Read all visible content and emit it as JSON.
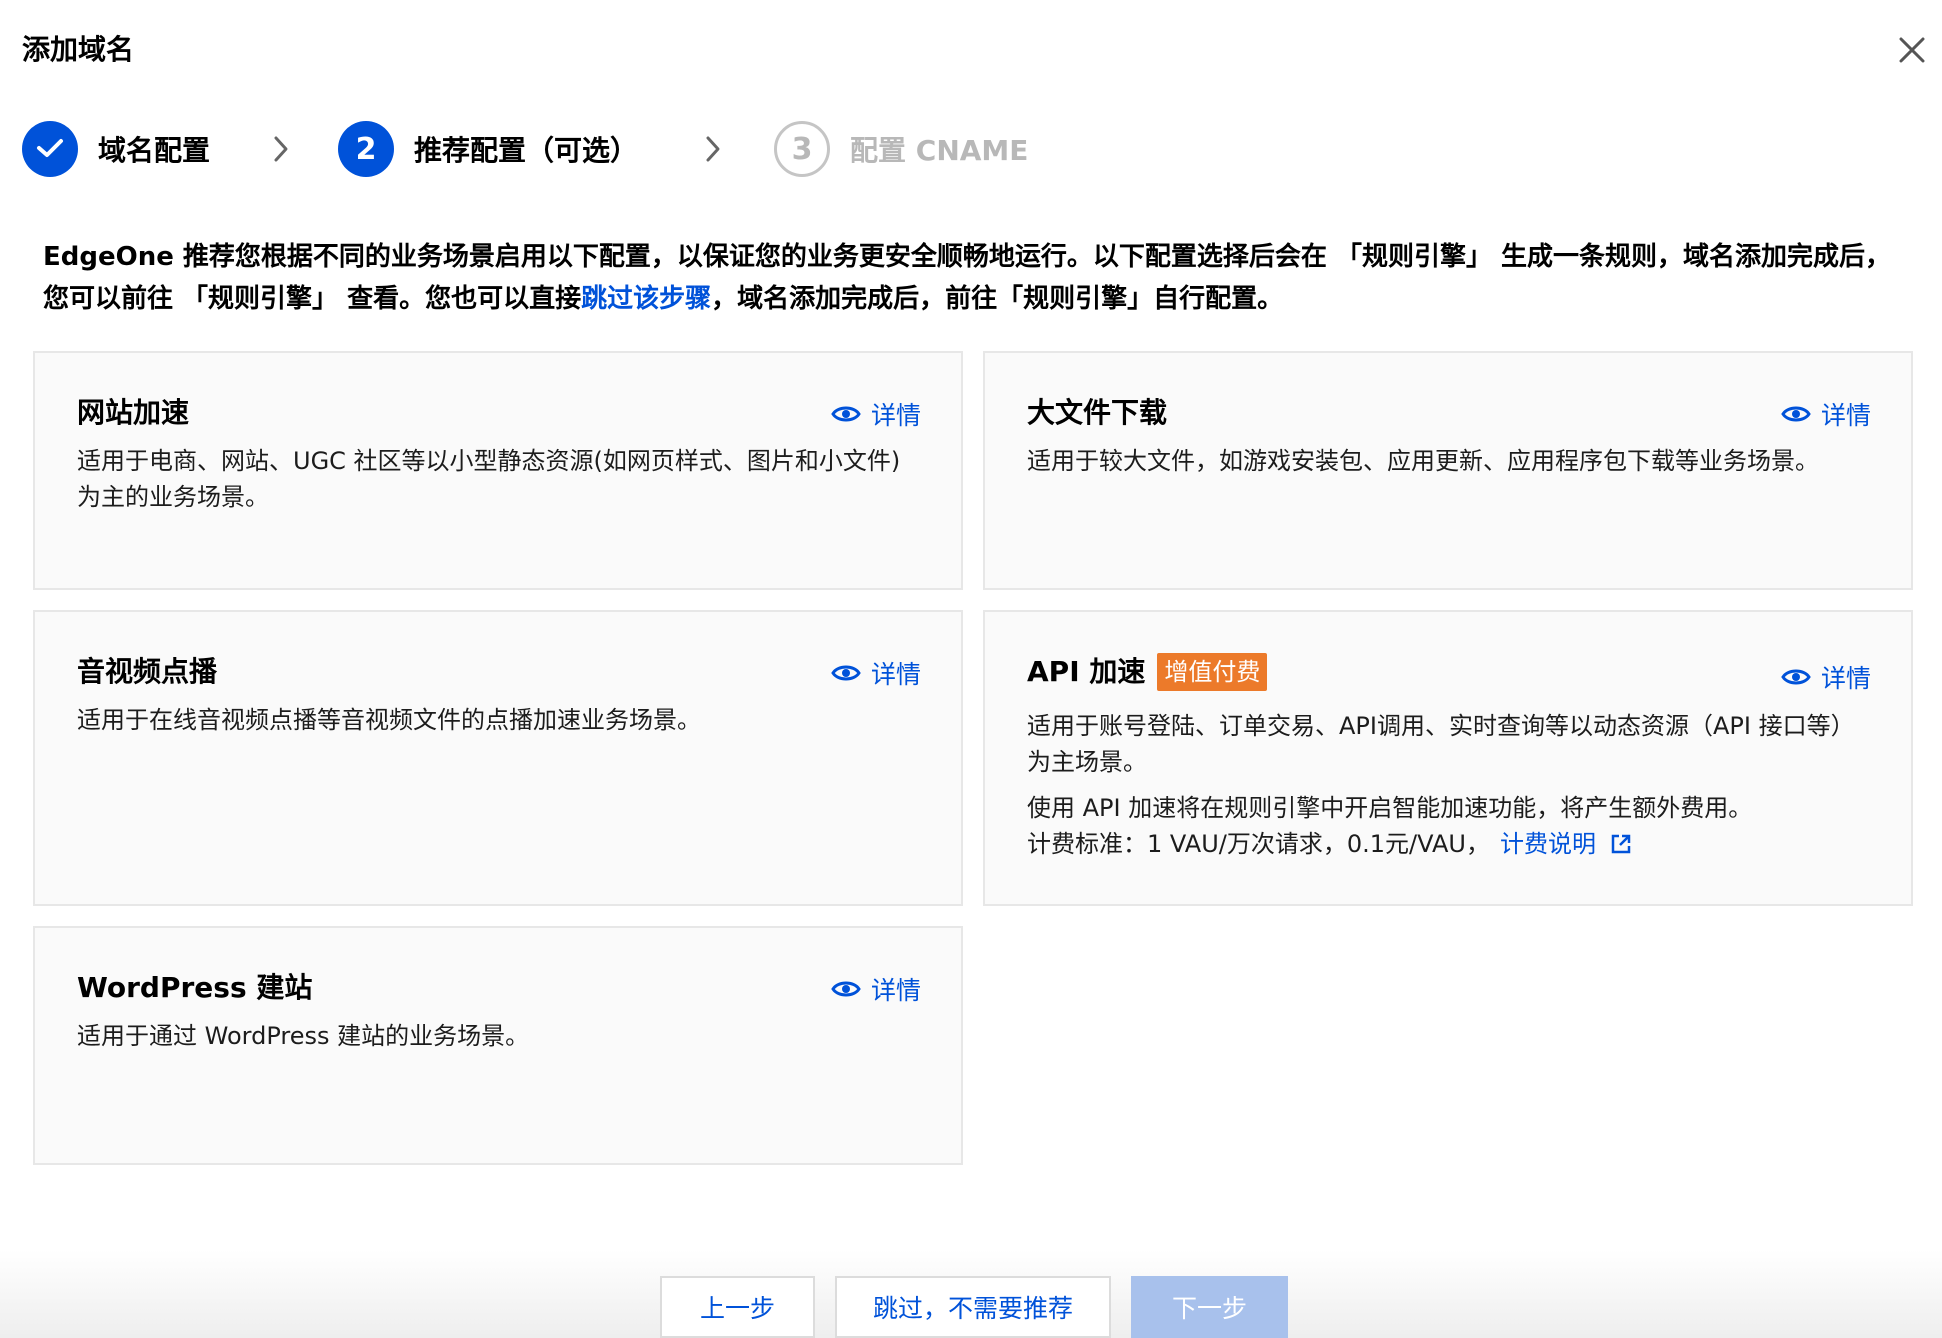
{
  "dialog": {
    "title": "添加域名"
  },
  "steps": [
    {
      "number": "1",
      "label": "域名配置",
      "state": "done"
    },
    {
      "number": "2",
      "label": "推荐配置（可选）",
      "state": "active"
    },
    {
      "number": "3",
      "label": "配置 CNAME",
      "state": "pending"
    }
  ],
  "intro": {
    "text_before": "EdgeOne 推荐您根据不同的业务场景启用以下配置，以保证您的业务更安全顺畅地运行。以下配置选择后会在 「规则引擎」 生成一条规则，域名添加完成后，您可以前往 「规则引擎」 查看。您也可以直接",
    "link": "跳过该步骤",
    "text_after": "，域名添加完成后，前往「规则引擎」自行配置。"
  },
  "detail_label": "详情",
  "cards": {
    "site": {
      "title": "网站加速",
      "desc": "适用于电商、网站、UGC 社区等以小型静态资源(如网页样式、图片和小文件)为主的业务场景。"
    },
    "bigfile": {
      "title": "大文件下载",
      "desc": "适用于较大文件，如游戏安装包、应用更新、应用程序包下载等业务场景。"
    },
    "vod": {
      "title": "音视频点播",
      "desc": "适用于在线音视频点播等音视频文件的点播加速业务场景。"
    },
    "api": {
      "title": "API 加速",
      "badge": "增值付费",
      "desc1": "适用于账号登陆、订单交易、API调用、实时查询等以动态资源（API 接口等）为主场景。",
      "desc2": "使用 API 加速将在规则引擎中开启智能加速功能，将产生额外费用。",
      "fee": "计费标准：1 VAU/万次请求，0.1元/VAU，",
      "fee_link": "计费说明"
    },
    "wordpress": {
      "title": "WordPress 建站",
      "desc": "适用于通过 WordPress 建站的业务场景。"
    }
  },
  "footer": {
    "prev": "上一步",
    "skip": "跳过，不需要推荐",
    "next": "下一步"
  },
  "colors": {
    "primary": "#0052d9",
    "badge": "#ec7a2a",
    "disabled_button": "#a8c1ec"
  },
  "icons": [
    "close-icon",
    "check-icon",
    "chevron-right-icon",
    "eye-icon",
    "external-link-icon"
  ]
}
